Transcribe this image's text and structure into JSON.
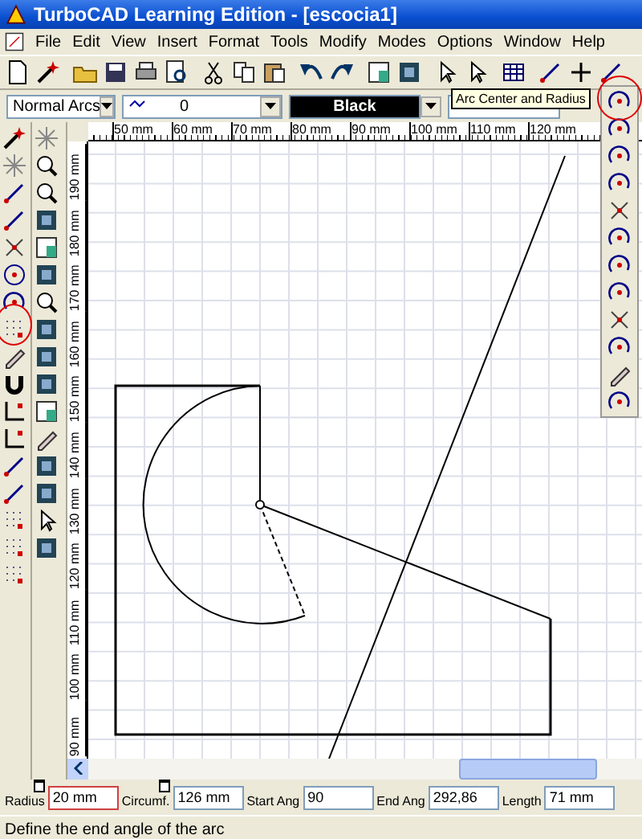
{
  "window": {
    "title": "TurboCAD Learning Edition - [escocia1]"
  },
  "menu": [
    "File",
    "Edit",
    "View",
    "Insert",
    "Format",
    "Tools",
    "Modify",
    "Modes",
    "Options",
    "Window",
    "Help"
  ],
  "property_bar": {
    "arc_mode": "Normal Arcs",
    "layer": "0",
    "color_label": "Black",
    "tooltip": "Arc Center and Radius"
  },
  "rulers": {
    "horizontal": [
      "50 mm",
      "60 mm",
      "70 mm",
      "80 mm",
      "90 mm",
      "100 mm",
      "110 mm",
      "120 mm"
    ],
    "vertical": [
      "190 mm",
      "180 mm",
      "170 mm",
      "160 mm",
      "150 mm",
      "140 mm",
      "130 mm",
      "120 mm",
      "110 mm",
      "100 mm",
      "90 mm"
    ]
  },
  "inspector": [
    {
      "label": "Radius",
      "value": "20 mm",
      "kind": "lockable",
      "highlighted": true
    },
    {
      "label": "Circumf.",
      "value": "126 mm",
      "kind": "lockable",
      "highlighted": false
    },
    {
      "label": "Start Ang",
      "value": "90",
      "kind": "plain",
      "highlighted": false
    },
    {
      "label": "End Ang",
      "value": "292,86",
      "kind": "plain",
      "highlighted": false
    },
    {
      "label": "Length",
      "value": "71 mm",
      "kind": "plain",
      "highlighted": false
    }
  ],
  "status_bar": "Define the end angle of the arc"
}
